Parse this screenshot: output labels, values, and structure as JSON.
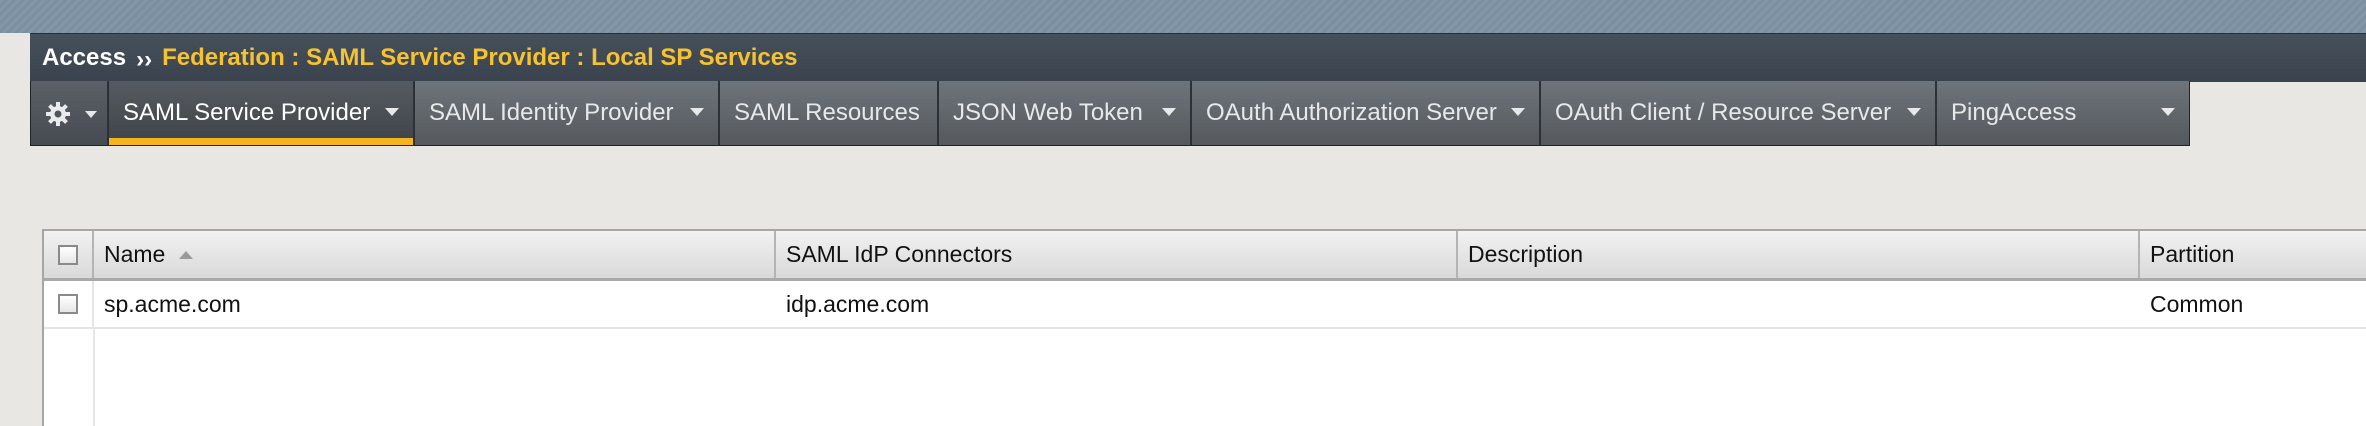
{
  "breadcrumb": {
    "root": "Access",
    "separator": "››",
    "path": "Federation : SAML Service Provider : Local SP Services"
  },
  "nav": {
    "tabs": [
      {
        "label": "SAML Service Provider",
        "active": true,
        "has_dropdown": true
      },
      {
        "label": "SAML Identity Provider",
        "active": false,
        "has_dropdown": true
      },
      {
        "label": "SAML Resources",
        "active": false,
        "has_dropdown": false
      },
      {
        "label": "JSON Web Token",
        "active": false,
        "has_dropdown": true
      },
      {
        "label": "OAuth Authorization Server",
        "active": false,
        "has_dropdown": true
      },
      {
        "label": "OAuth Client / Resource Server",
        "active": false,
        "has_dropdown": true
      },
      {
        "label": "PingAccess",
        "active": false,
        "has_dropdown": true
      }
    ],
    "gear_icon": "gear-icon",
    "active_accent": "#f5b41e"
  },
  "table": {
    "columns": [
      "Name",
      "SAML IdP Connectors",
      "Description",
      "Partition"
    ],
    "sort_column": "Name",
    "rows": [
      {
        "name": "sp.acme.com",
        "connectors": "idp.acme.com",
        "description": "",
        "partition": "Common"
      }
    ]
  },
  "colors": {
    "breadcrumb_path": "#f5c232",
    "titlebar": "#3f4852"
  }
}
